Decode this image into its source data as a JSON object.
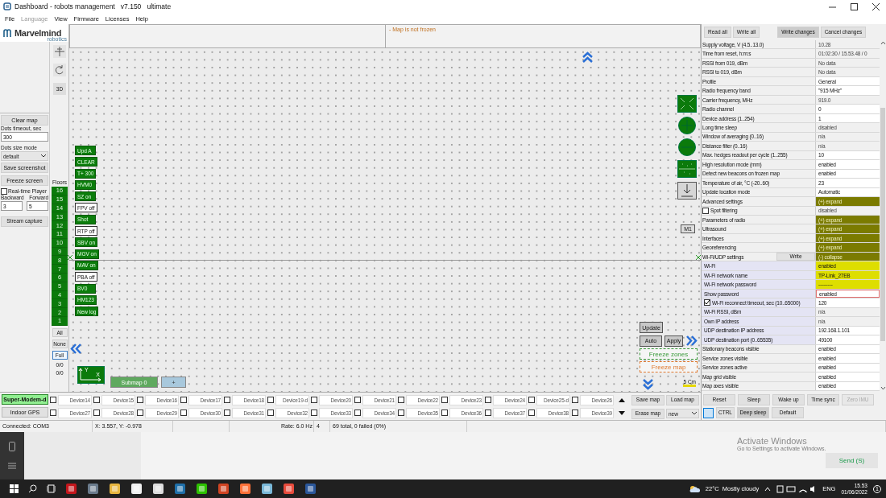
{
  "window": {
    "title": "Dashboard - robots management   v7.150   ultimate"
  },
  "menu": [
    {
      "label": "File",
      "disabled": false
    },
    {
      "label": "Language",
      "disabled": true
    },
    {
      "label": "View",
      "disabled": false
    },
    {
      "label": "Firmware",
      "disabled": false
    },
    {
      "label": "Licenses",
      "disabled": false
    },
    {
      "label": "Help",
      "disabled": false
    }
  ],
  "logo": {
    "name": "Marvelmind",
    "sub": "robotics"
  },
  "left_panel": {
    "clear_map": "Clear map",
    "dots_timeout_label": "Dots timeout, sec",
    "dots_timeout": "300",
    "dots_size_label": "Dots size mode",
    "dots_size": "default",
    "save_screenshot": "Save screenshot",
    "freeze_screen": "Freeze screen",
    "realtime": {
      "label": "Real-time Player",
      "checked": false
    },
    "backward_label": "Backward",
    "forward_label": "Forward",
    "backward": "3",
    "forward": "5",
    "stream_capture": "Stream capture"
  },
  "tools": {
    "view_3d": "3D"
  },
  "floors": {
    "title": "Floors",
    "items": [
      {
        "label": "16",
        "selected": true
      },
      {
        "label": "15",
        "selected": true
      },
      {
        "label": "14",
        "selected": true
      },
      {
        "label": "13",
        "selected": true
      },
      {
        "label": "12",
        "selected": true
      },
      {
        "label": "11",
        "selected": true
      },
      {
        "label": "10",
        "selected": true
      },
      {
        "label": "9",
        "selected": true
      },
      {
        "label": "8",
        "selected": true
      },
      {
        "label": "7",
        "selected": true
      },
      {
        "label": "6",
        "selected": true
      },
      {
        "label": "5",
        "selected": true
      },
      {
        "label": "4",
        "selected": true
      },
      {
        "label": "3",
        "selected": true
      },
      {
        "label": "2",
        "selected": true
      },
      {
        "label": "1",
        "selected": true
      }
    ],
    "filters": [
      {
        "label": "All",
        "selected": false
      },
      {
        "label": "None",
        "selected": false
      },
      {
        "label": "Full",
        "selected": true
      }
    ],
    "counters": [
      "0/0",
      "0/0"
    ]
  },
  "map": {
    "status": "- Map is not frozen",
    "commands": [
      {
        "label": "Upd A",
        "on": true
      },
      {
        "label": "CLEAR",
        "on": true
      },
      {
        "label": "T+ 300",
        "on": true
      },
      {
        "label": "HVM0",
        "on": true
      },
      {
        "label": "SZ on",
        "on": true
      },
      {
        "label": "FPV off",
        "on": false
      },
      {
        "label": "Shot",
        "on": true
      },
      {
        "label": "RTP off",
        "on": false
      },
      {
        "label": "SBV on",
        "on": true
      },
      {
        "label": "MGV on",
        "on": true
      },
      {
        "label": "MAV on",
        "on": true
      },
      {
        "label": "PBA off",
        "on": false
      },
      {
        "label": "BV0",
        "on": true
      },
      {
        "label": "HM123",
        "on": true
      },
      {
        "label": "New log",
        "on": true
      }
    ],
    "marker": "M1",
    "update": "Update",
    "auto": "Auto",
    "apply": "Apply",
    "freeze_zones": "Freeze zones",
    "freeze_map": "Freeze map",
    "scale": "5 Cm",
    "axis_y": "Y",
    "axis_x": "X",
    "submap": "Submap 0",
    "add_submap": "+"
  },
  "modems": [
    {
      "label": "Super-Modem-d",
      "selected": true
    },
    {
      "label": "Indoor GPS",
      "selected": false
    }
  ],
  "devices": [
    {
      "label": "Device14",
      "checked": false
    },
    {
      "label": "Device15",
      "checked": false
    },
    {
      "label": "Device16",
      "checked": false
    },
    {
      "label": "Device17",
      "checked": false
    },
    {
      "label": "Device18",
      "checked": false
    },
    {
      "label": "Device19-d",
      "checked": false
    },
    {
      "label": "Device20",
      "checked": false
    },
    {
      "label": "Device21",
      "checked": false
    },
    {
      "label": "Device22",
      "checked": false
    },
    {
      "label": "Device23",
      "checked": false
    },
    {
      "label": "Device24",
      "checked": false
    },
    {
      "label": "Device25-d",
      "checked": false
    },
    {
      "label": "Device26",
      "checked": false
    },
    {
      "label": "Device27",
      "checked": false
    },
    {
      "label": "Device28",
      "checked": false
    },
    {
      "label": "Device29",
      "checked": false
    },
    {
      "label": "Device30",
      "checked": false
    },
    {
      "label": "Device31",
      "checked": false
    },
    {
      "label": "Device32",
      "checked": false
    },
    {
      "label": "Device33",
      "checked": false
    },
    {
      "label": "Device34",
      "checked": false
    },
    {
      "label": "Device35",
      "checked": false
    },
    {
      "label": "Device36",
      "checked": false
    },
    {
      "label": "Device37",
      "checked": false
    },
    {
      "label": "Device38",
      "checked": false
    },
    {
      "label": "Device39",
      "checked": false
    }
  ],
  "map_files": {
    "save": "Save map",
    "load": "Load map",
    "erase": "Erase map",
    "select": "new"
  },
  "status_bar": {
    "connection": "Connected: COM3",
    "position": "X: 3.557, Y: -0.978",
    "rate": "Rate: 6.0 Hz",
    "count": "4",
    "summary": "69 total, 0 failed (0%)"
  },
  "settings": {
    "actions": [
      {
        "label": "Read all",
        "pressed": false
      },
      {
        "label": "Write all",
        "pressed": false
      },
      {
        "label": "Write changes",
        "pressed": true
      },
      {
        "label": "Cancel changes",
        "pressed": false
      }
    ],
    "rows": [
      {
        "kind": "plain",
        "label": "Supply voltage, V (4.5..13.0)",
        "value": "10.28",
        "readonly": true,
        "highlight": false,
        "focused": false
      },
      {
        "kind": "plain",
        "label": "Time from reset, h:m:s",
        "value": "01:02:30 / 15.53.48 / 0",
        "readonly": true,
        "highlight": false,
        "focused": false
      },
      {
        "kind": "plain",
        "label": "RSSI from 019, dBm",
        "value": "No data",
        "readonly": true,
        "highlight": false,
        "focused": false
      },
      {
        "kind": "plain",
        "label": "RSSI to 019, dBm",
        "value": "No data",
        "readonly": true,
        "highlight": false,
        "focused": false
      },
      {
        "kind": "plain",
        "label": "Profile",
        "value": "General",
        "readonly": false,
        "highlight": false,
        "focused": false
      },
      {
        "kind": "plain",
        "label": "Radio frequency band",
        "value": "\"915 MHz\"",
        "readonly": false,
        "highlight": false,
        "focused": false
      },
      {
        "kind": "plain",
        "label": "Carrier frequency, MHz",
        "value": "919.0",
        "readonly": true,
        "highlight": false,
        "focused": false
      },
      {
        "kind": "plain",
        "label": "Radio channel",
        "value": "0",
        "readonly": false,
        "highlight": false,
        "focused": false
      },
      {
        "kind": "plain",
        "label": "Device address (1..254)",
        "value": "1",
        "readonly": false,
        "highlight": false,
        "focused": false
      },
      {
        "kind": "plain",
        "label": "Long time sleep",
        "value": "disabled",
        "readonly": true,
        "highlight": false,
        "focused": false
      },
      {
        "kind": "plain",
        "label": "Window of averaging (0..16)",
        "value": "n/a",
        "readonly": true,
        "highlight": false,
        "focused": false
      },
      {
        "kind": "plain",
        "label": "Distance filter (0..16)",
        "value": "n/a",
        "readonly": true,
        "highlight": false,
        "focused": false
      },
      {
        "kind": "plain",
        "label": "Max. hedges readout per cycle (1..255)",
        "value": "10",
        "readonly": false,
        "highlight": false,
        "focused": false
      },
      {
        "kind": "plain",
        "label": "High resolution mode (mm)",
        "value": "enabled",
        "readonly": false,
        "highlight": false,
        "focused": false
      },
      {
        "kind": "plain",
        "label": "Detect new beacons on frozen map",
        "value": "enabled",
        "readonly": false,
        "highlight": false,
        "focused": false
      },
      {
        "kind": "plain",
        "label": "Temperature of air, °C (-20..60)",
        "value": "23",
        "readonly": false,
        "highlight": false,
        "focused": false
      },
      {
        "kind": "plain",
        "label": "Update location mode",
        "value": "Automatic",
        "readonly": false,
        "highlight": false,
        "focused": false
      },
      {
        "kind": "section",
        "label": "Advanced settings",
        "value": "(+) expand",
        "focused": false
      },
      {
        "kind": "plain",
        "label": "Spot filtering",
        "value": "disabled",
        "readonly": true,
        "highlight": false,
        "focused": false,
        "checked": false
      },
      {
        "kind": "section",
        "label": "Parameters of radio",
        "value": "(+) expand",
        "focused": false
      },
      {
        "kind": "section",
        "label": "Ultrasound",
        "value": "(+) expand",
        "focused": false
      },
      {
        "kind": "section",
        "label": "Interfaces",
        "value": "(+) expand",
        "focused": false
      },
      {
        "kind": "section",
        "label": "Georeferencing",
        "value": "(+) expand",
        "focused": false
      },
      {
        "kind": "section",
        "label": "Wi-Fi/UDP settings",
        "value": "(-) collapse",
        "focused": false,
        "button": "Write"
      },
      {
        "kind": "sub",
        "label": "Wi-Fi",
        "value": "enabled",
        "readonly": false,
        "highlight": true,
        "focused": false
      },
      {
        "kind": "sub",
        "label": "Wi-Fi network name",
        "value": "TP-Link_27EB",
        "readonly": false,
        "highlight": true,
        "focused": false
      },
      {
        "kind": "sub",
        "label": "Wi-Fi network password",
        "value": "---------",
        "readonly": false,
        "highlight": true,
        "focused": false
      },
      {
        "kind": "sub",
        "label": "Show password",
        "value": "enabled",
        "readonly": false,
        "highlight": false,
        "focused": true
      },
      {
        "kind": "sub",
        "label": "Wi-Fi reconnect timeout, sec (10..65000)",
        "value": "120",
        "readonly": false,
        "highlight": false,
        "focused": false,
        "checked": true
      },
      {
        "kind": "sub",
        "label": "Wi-Fi RSSI, dBm",
        "value": "n/a",
        "readonly": true,
        "highlight": false,
        "focused": false
      },
      {
        "kind": "sub",
        "label": "Own IP address",
        "value": "n/a",
        "readonly": true,
        "highlight": false,
        "focused": false
      },
      {
        "kind": "sub",
        "label": "UDP destination IP address",
        "value": "192.168.1.101",
        "readonly": false,
        "highlight": false,
        "focused": false
      },
      {
        "kind": "sub",
        "label": "UDP destination port (0..65535)",
        "value": "49100",
        "readonly": false,
        "highlight": false,
        "focused": false
      },
      {
        "kind": "plain",
        "label": "Stationary beacons visible",
        "value": "enabled",
        "readonly": false,
        "highlight": false,
        "focused": false
      },
      {
        "kind": "plain",
        "label": "Service zones visible",
        "value": "enabled",
        "readonly": false,
        "highlight": false,
        "focused": false
      },
      {
        "kind": "plain",
        "label": "Service zones active",
        "value": "enabled",
        "readonly": false,
        "highlight": false,
        "focused": false
      },
      {
        "kind": "plain",
        "label": "Map grid visible",
        "value": "enabled",
        "readonly": false,
        "highlight": false,
        "focused": false
      },
      {
        "kind": "plain",
        "label": "Map axes visible",
        "value": "enabled",
        "readonly": false,
        "highlight": false,
        "focused": false
      }
    ],
    "commands": [
      {
        "label": "Reset",
        "disabled": false
      },
      {
        "label": "Sleep",
        "disabled": false
      },
      {
        "label": "Wake up",
        "disabled": false
      },
      {
        "label": "Time sync",
        "disabled": false
      },
      {
        "label": "Zero IMU",
        "disabled": true
      }
    ],
    "commands_2": [
      {
        "label": "CTRL",
        "pressed": false
      },
      {
        "label": "Deep sleep",
        "pressed": true
      },
      {
        "label": "Default",
        "pressed": false
      }
    ]
  },
  "desktop": {
    "activate_title": "Activate Windows",
    "activate_text": "Go to Settings to activate Windows.",
    "send": "Send (S)"
  },
  "taskbar": {
    "weather": "22°C  Mostly cloudy",
    "language": "ENG",
    "time": "15.53",
    "date": "01/06/2022",
    "notifications": "1"
  }
}
